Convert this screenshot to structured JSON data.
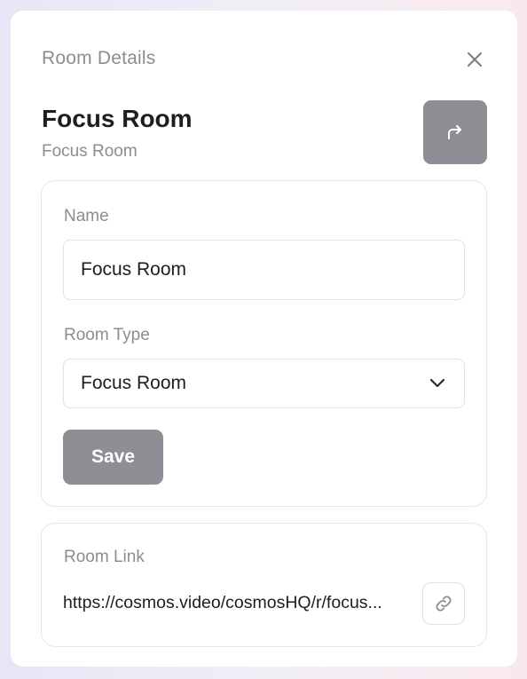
{
  "header": {
    "title": "Room Details",
    "close_icon": "close-icon"
  },
  "room": {
    "title": "Focus Room",
    "subtitle": "Focus Room",
    "share_icon": "share-arrow-icon"
  },
  "form": {
    "name_label": "Name",
    "name_value": "Focus Room",
    "type_label": "Room Type",
    "type_value": "Focus Room",
    "save_label": "Save"
  },
  "link": {
    "label": "Room Link",
    "url": "https://cosmos.video/cosmosHQ/r/focus...",
    "copy_icon": "link-icon"
  },
  "colors": {
    "button_bg": "#8e8e95",
    "text_primary": "#1d1d22",
    "text_muted": "#8c8c94"
  }
}
